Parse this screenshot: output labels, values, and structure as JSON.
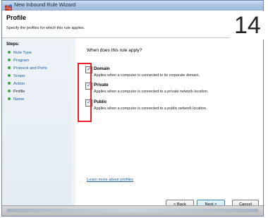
{
  "window": {
    "title": "New Inbound Rule Wizard"
  },
  "badge_number": "14",
  "header": {
    "title": "Profile",
    "subtitle": "Specify the profiles for which this rule applies."
  },
  "steps": {
    "heading": "Steps:",
    "items": [
      {
        "label": "Rule Type"
      },
      {
        "label": "Program"
      },
      {
        "label": "Protocol and Ports"
      },
      {
        "label": "Scope"
      },
      {
        "label": "Action"
      },
      {
        "label": "Profile"
      },
      {
        "label": "Name"
      }
    ]
  },
  "content": {
    "question": "When does this rule apply?",
    "options": [
      {
        "label": "Domain",
        "description": "Applies when a computer is connected to its corporate domain.",
        "checked": true
      },
      {
        "label": "Private",
        "description": "Applies when a computer is connected to a private network location.",
        "checked": true
      },
      {
        "label": "Public",
        "description": "Applies when a computer is connected to a public network location.",
        "checked": true
      }
    ],
    "learn_more": "Learn more about profiles"
  },
  "buttons": {
    "back": "< Back",
    "next": "Next >",
    "cancel": "Cancel"
  },
  "colors": {
    "highlight": "#e2232a",
    "link": "#1b5eab",
    "step_dot": "#3aa53a"
  }
}
